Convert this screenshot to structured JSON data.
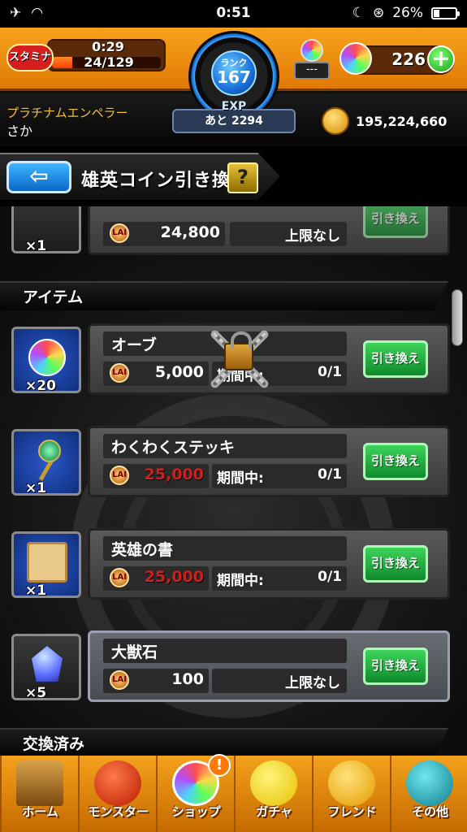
{
  "status_bar": {
    "time": "0:51",
    "battery": "26%",
    "battery_level": 0.26
  },
  "header": {
    "stamina_label": "スタミナ",
    "stamina_timer": "0:29",
    "stamina_value": "24/129",
    "stamina_level": 0.19,
    "rank_label": "ランク",
    "rank": "167",
    "exp_label": "EXP",
    "exp_remaining": "あと 2294",
    "luck_box": "---",
    "orb_count": "226",
    "player_title": "プラチナムエンペラー",
    "player_name": "さか",
    "gold": "195,224,660"
  },
  "banner": {
    "back": "⇦",
    "title": "雄英コイン引き換え",
    "help": "?"
  },
  "top_row": {
    "price": "24,800",
    "limit": "上限なし",
    "qty": "×1",
    "button": "引き換え"
  },
  "sections": {
    "items": "アイテム",
    "exchanged": "交換済み"
  },
  "items": [
    {
      "name": "オーブ",
      "price": "5,000",
      "limit_label": "期間中:",
      "limit_value": "0/1",
      "qty": "×20",
      "button": "引き換え",
      "locked": true
    },
    {
      "name": "わくわくステッキ",
      "price": "25,000",
      "limit_label": "期間中:",
      "limit_value": "0/1",
      "qty": "×1",
      "button": "引き換え"
    },
    {
      "name": "英雄の書",
      "price": "25,000",
      "limit_label": "期間中:",
      "limit_value": "0/1",
      "qty": "×1",
      "button": "引き換え"
    },
    {
      "name": "大獣石",
      "price": "100",
      "limit_value": "上限なし",
      "qty": "×5",
      "button": "引き換え"
    }
  ],
  "coin_label": "LAI",
  "nav": [
    {
      "label": "ホーム",
      "icon": "home-icon"
    },
    {
      "label": "モンスター",
      "icon": "monster-icon"
    },
    {
      "label": "ショップ",
      "icon": "shop-orb-icon"
    },
    {
      "label": "ガチャ",
      "icon": "gacha-egg-icon"
    },
    {
      "label": "フレンド",
      "icon": "friend-icon"
    },
    {
      "label": "その他",
      "icon": "other-icon"
    }
  ],
  "nav_badge": "!",
  "colors": {
    "header_orange": "#f7a21b",
    "price_red": "#d21d1d",
    "exchange_green": "#3ed35a",
    "accent_blue": "#1a6fd8"
  }
}
